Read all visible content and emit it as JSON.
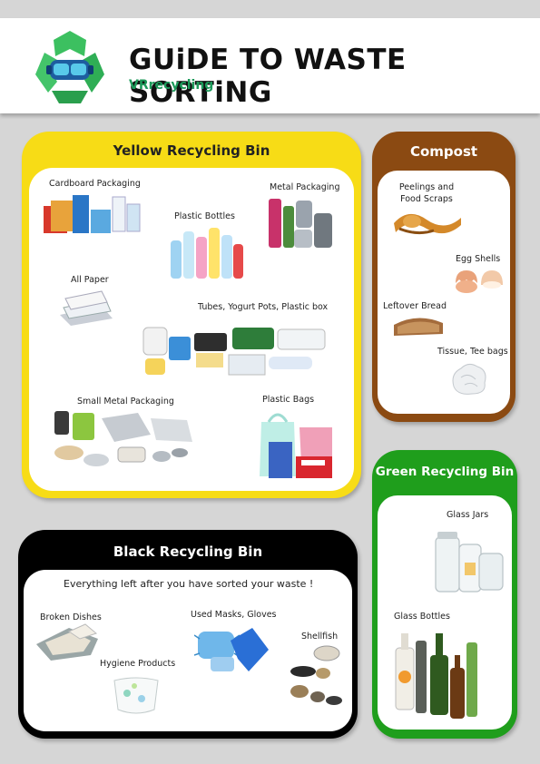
{
  "header": {
    "title": "GUiDE TO WASTE SORTiNG",
    "brand": "VRrecycling"
  },
  "yellow_bin": {
    "title": "Yellow Recycling Bin",
    "color": "#f7dc16",
    "items": {
      "cardboard": "Cardboard Packaging",
      "plastic_bottles": "Plastic Bottles",
      "metal": "Metal Packaging",
      "paper": "All Paper",
      "tubes": "Tubes, Yogurt Pots, Plastic box",
      "small_metal": "Small Metal Packaging",
      "plastic_bags": "Plastic Bags"
    }
  },
  "compost": {
    "title": "Compost",
    "color": "#8b4a12",
    "items": {
      "peelings": "Peelings and Food Scraps",
      "eggs": "Egg Shells",
      "bread": "Leftover Bread",
      "tissue": "Tissue, Tee bags"
    }
  },
  "green_bin": {
    "title": "Green Recycling Bin",
    "color": "#1f9e1c",
    "items": {
      "jars": "Glass Jars",
      "bottles": "Glass Bottles"
    }
  },
  "black_bin": {
    "title": "Black Recycling Bin",
    "color": "#000000",
    "note": "Everything left after you have sorted your waste !",
    "items": {
      "dishes": "Broken Dishes",
      "masks": "Used Masks, Gloves",
      "shellfish": "Shellfish",
      "hygiene": "Hygiene Products"
    }
  }
}
